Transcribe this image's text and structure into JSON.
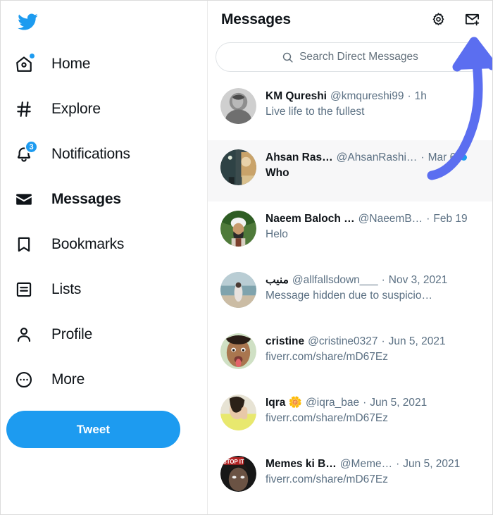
{
  "app": {
    "logo_icon": "twitter-bird-icon",
    "accent_color": "#1d9bf0",
    "annotation_color": "#5b6ef0"
  },
  "sidebar": {
    "items": [
      {
        "label": "Home",
        "icon": "home-icon",
        "active": false,
        "badge_dot": true,
        "badge_count": ""
      },
      {
        "label": "Explore",
        "icon": "hashtag-icon",
        "active": false,
        "badge_dot": false,
        "badge_count": ""
      },
      {
        "label": "Notifications",
        "icon": "bell-icon",
        "active": false,
        "badge_dot": false,
        "badge_count": "3"
      },
      {
        "label": "Messages",
        "icon": "envelope-icon",
        "active": true,
        "badge_dot": false,
        "badge_count": ""
      },
      {
        "label": "Bookmarks",
        "icon": "bookmark-icon",
        "active": false,
        "badge_dot": false,
        "badge_count": ""
      },
      {
        "label": "Lists",
        "icon": "list-icon",
        "active": false,
        "badge_dot": false,
        "badge_count": ""
      },
      {
        "label": "Profile",
        "icon": "person-icon",
        "active": false,
        "badge_dot": false,
        "badge_count": ""
      },
      {
        "label": "More",
        "icon": "more-circle-icon",
        "active": false,
        "badge_dot": false,
        "badge_count": ""
      }
    ],
    "tweet_button_label": "Tweet"
  },
  "header": {
    "title": "Messages",
    "settings_icon": "gear-icon",
    "new_message_icon": "new-message-icon"
  },
  "search": {
    "icon": "search-icon",
    "placeholder": "Search Direct Messages",
    "value": ""
  },
  "conversations": [
    {
      "name": "KM Qureshi",
      "handle": "@kmqureshi99",
      "separator": "·",
      "time": "1h",
      "preview": "Live life to the fullest",
      "unread": false,
      "selected": false,
      "avatar": "photo-man-grayscale"
    },
    {
      "name": "Ahsan Ras…",
      "handle": "@AhsanRashi…",
      "separator": "·",
      "time": "Mar 6",
      "preview": "Who",
      "unread": true,
      "selected": true,
      "avatar": "photo-indoor-scene"
    },
    {
      "name": "Naeem Baloch …",
      "handle": "@NaeemB…",
      "separator": "·",
      "time": "Feb 19",
      "preview": "Helo",
      "unread": false,
      "selected": false,
      "avatar": "photo-man-turban"
    },
    {
      "name": "منیب",
      "handle": "@allfallsdown___",
      "separator": "·",
      "time": "Nov 3, 2021",
      "preview": "Message hidden due to suspicio…",
      "unread": false,
      "selected": false,
      "avatar": "photo-beach"
    },
    {
      "name": "cristine",
      "handle": "@cristine0327",
      "separator": "·",
      "time": "Jun 5, 2021",
      "preview": "fiverr.com/share/mD67Ez",
      "unread": false,
      "selected": false,
      "avatar": "photo-woman-tongue"
    },
    {
      "name": "Iqra 🌼",
      "handle": "@iqra_bae",
      "separator": "·",
      "time": "Jun 5, 2021",
      "preview": "fiverr.com/share/mD67Ez",
      "unread": false,
      "selected": false,
      "avatar": "photo-woman-yellow"
    },
    {
      "name": "Memes ki B…",
      "handle": "@Meme…",
      "separator": "·",
      "time": "Jun 5, 2021",
      "preview": "fiverr.com/share/mD67Ez",
      "unread": false,
      "selected": false,
      "avatar": "photo-meme-obama"
    }
  ],
  "annotation": {
    "type": "curved-arrow",
    "points_to": "new-message-icon",
    "color": "#5b6ef0"
  }
}
